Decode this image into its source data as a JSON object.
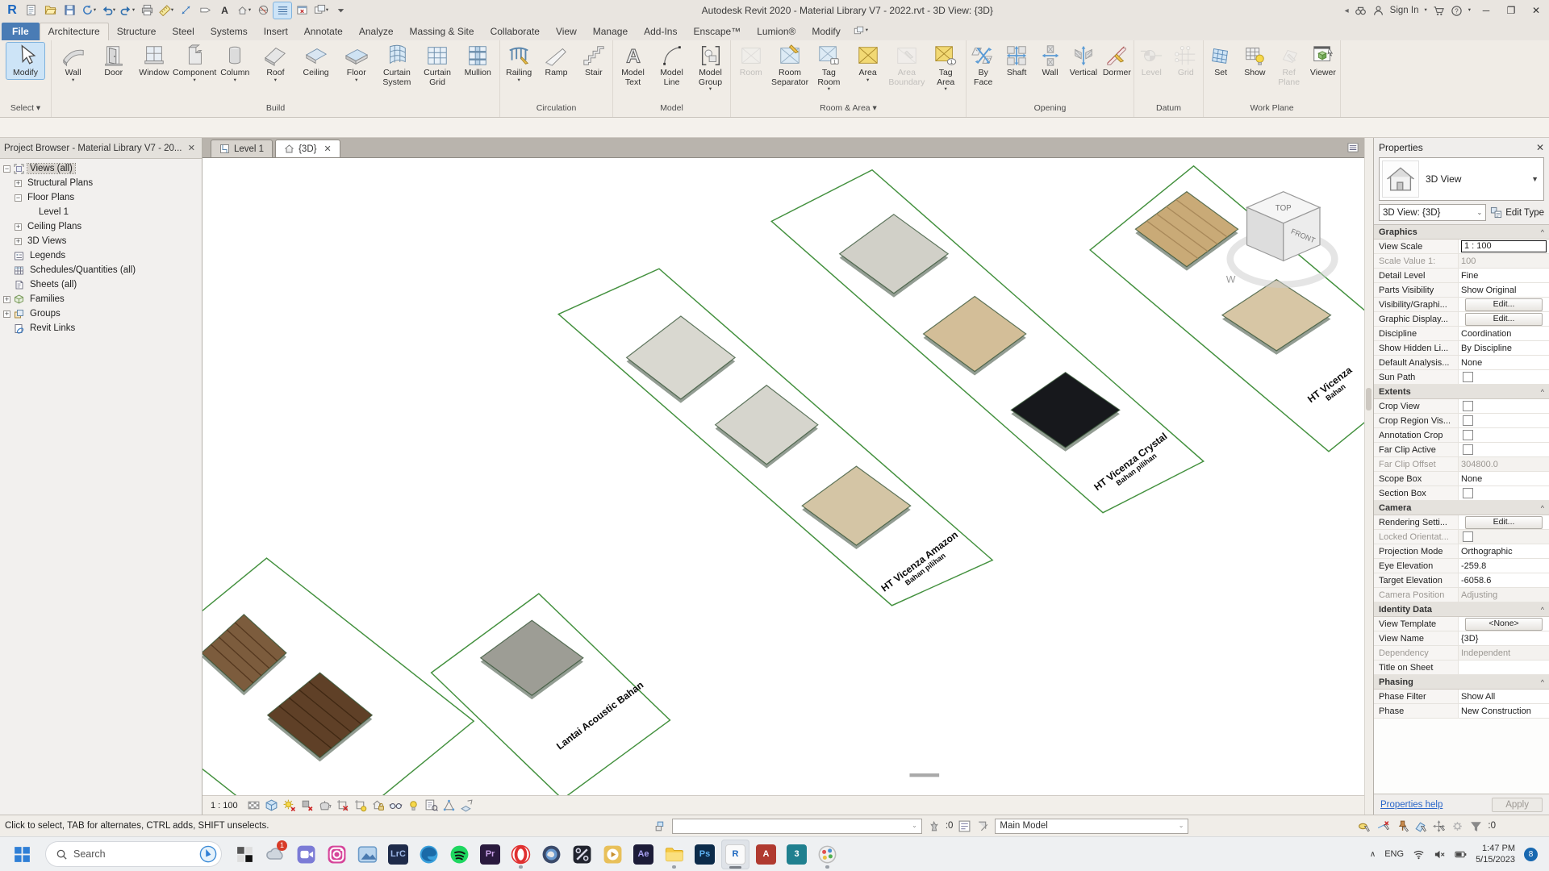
{
  "title_bar": {
    "title": "Autodesk Revit 2020 - Material Library V7 - 2022.rvt - 3D View: {3D}",
    "sign_in": "Sign In"
  },
  "qat": [
    {
      "icon": "doc"
    },
    {
      "icon": "open"
    },
    {
      "icon": "save"
    },
    {
      "icon": "sync",
      "arrow": true
    },
    {
      "icon": "undo",
      "arrow": true
    },
    {
      "icon": "redo",
      "arrow": true
    },
    {
      "icon": "print"
    },
    {
      "icon": "measure",
      "arrow": true
    },
    {
      "icon": "aligndim"
    },
    {
      "icon": "tagq"
    },
    {
      "icon": "texta"
    },
    {
      "icon": "cube3d",
      "arrow": true
    },
    {
      "icon": "section"
    },
    {
      "icon": "thinlines",
      "active": true
    },
    {
      "icon": "closehidden"
    },
    {
      "icon": "switchwin",
      "arrow": true
    },
    {
      "icon": "qatdrop"
    }
  ],
  "ribbon": {
    "tabs": [
      {
        "label": "File",
        "file": true
      },
      {
        "label": "Architecture",
        "active": true
      },
      {
        "label": "Structure"
      },
      {
        "label": "Steel"
      },
      {
        "label": "Systems"
      },
      {
        "label": "Insert"
      },
      {
        "label": "Annotate"
      },
      {
        "label": "Analyze"
      },
      {
        "label": "Massing & Site"
      },
      {
        "label": "Collaborate"
      },
      {
        "label": "View"
      },
      {
        "label": "Manage"
      },
      {
        "label": "Add-Ins"
      },
      {
        "label": "Enscape™"
      },
      {
        "label": "Lumion®"
      },
      {
        "label": "Modify"
      }
    ],
    "panels": [
      {
        "label": "Select ▾",
        "buttons": [
          {
            "label": "Modify",
            "icon": "modify",
            "selected": true
          }
        ]
      },
      {
        "label": "Build",
        "buttons": [
          {
            "label": "Wall",
            "icon": "wall",
            "arrow": true
          },
          {
            "label": "Door",
            "icon": "door"
          },
          {
            "label": "Window",
            "icon": "window"
          },
          {
            "label": "Component",
            "icon": "component",
            "arrow": true
          },
          {
            "label": "Column",
            "icon": "column",
            "arrow": true
          },
          {
            "label": "Roof",
            "icon": "roof",
            "arrow": true
          },
          {
            "label": "Ceiling",
            "icon": "ceiling"
          },
          {
            "label": "Floor",
            "icon": "floor",
            "arrow": true
          },
          {
            "label": "Curtain\nSystem",
            "icon": "curtainsys"
          },
          {
            "label": "Curtain\nGrid",
            "icon": "curtaingrid"
          },
          {
            "label": "Mullion",
            "icon": "mullion"
          }
        ]
      },
      {
        "label": "Circulation",
        "buttons": [
          {
            "label": "Railing",
            "icon": "railing",
            "arrow": true
          },
          {
            "label": "Ramp",
            "icon": "ramp"
          },
          {
            "label": "Stair",
            "icon": "stair"
          }
        ]
      },
      {
        "label": "Model",
        "buttons": [
          {
            "label": "Model\nText",
            "icon": "modeltext"
          },
          {
            "label": "Model\nLine",
            "icon": "modelline"
          },
          {
            "label": "Model\nGroup",
            "icon": "modelgroup",
            "arrow": true
          }
        ]
      },
      {
        "label": "Room & Area ▾",
        "buttons": [
          {
            "label": "Room",
            "icon": "room",
            "disabled": true
          },
          {
            "label": "Room\nSeparator",
            "icon": "roomsep"
          },
          {
            "label": "Tag\nRoom",
            "icon": "tagroom",
            "arrow": true
          },
          {
            "label": "Area",
            "icon": "area",
            "arrow": true
          },
          {
            "label": "Area\nBoundary",
            "icon": "areabnd",
            "disabled": true
          },
          {
            "label": "Tag\nArea",
            "icon": "tagarea",
            "arrow": true
          }
        ]
      },
      {
        "label": "Opening",
        "buttons": [
          {
            "label": "By\nFace",
            "icon": "byface"
          },
          {
            "label": "Shaft",
            "icon": "shaft"
          },
          {
            "label": "Wall",
            "icon": "wallopen"
          },
          {
            "label": "Vertical",
            "icon": "vertopen"
          },
          {
            "label": "Dormer",
            "icon": "dormer"
          }
        ]
      },
      {
        "label": "Datum",
        "buttons": [
          {
            "label": "Level",
            "icon": "level",
            "disabled": true
          },
          {
            "label": "Grid",
            "icon": "grid",
            "disabled": true
          }
        ]
      },
      {
        "label": "Work Plane",
        "buttons": [
          {
            "label": "Set",
            "icon": "set"
          },
          {
            "label": "Show",
            "icon": "show"
          },
          {
            "label": "Ref\nPlane",
            "icon": "refplane",
            "disabled": true
          },
          {
            "label": "Viewer",
            "icon": "viewer"
          }
        ]
      }
    ]
  },
  "project_browser": {
    "title": "Project Browser - Material Library V7 - 20...",
    "items": [
      {
        "label": "Views (all)",
        "level": 0,
        "exp": "minus",
        "icon": "views",
        "selected": true
      },
      {
        "label": "Structural Plans",
        "level": 1,
        "exp": "plus"
      },
      {
        "label": "Floor Plans",
        "level": 1,
        "exp": "minus"
      },
      {
        "label": "Level 1",
        "level": 2
      },
      {
        "label": "Ceiling Plans",
        "level": 1,
        "exp": "plus"
      },
      {
        "label": "3D Views",
        "level": 1,
        "exp": "plus"
      },
      {
        "label": "Legends",
        "level": 0,
        "icon": "legends"
      },
      {
        "label": "Schedules/Quantities (all)",
        "level": 0,
        "icon": "sched"
      },
      {
        "label": "Sheets (all)",
        "level": 0,
        "icon": "sheets"
      },
      {
        "label": "Families",
        "level": 0,
        "exp": "plus",
        "icon": "families"
      },
      {
        "label": "Groups",
        "level": 0,
        "exp": "plus",
        "icon": "groups"
      },
      {
        "label": "Revit Links",
        "level": 0,
        "icon": "links"
      }
    ]
  },
  "view_tabs": [
    {
      "label": "Level 1",
      "icon": "plan"
    },
    {
      "label": "{3D}",
      "icon": "home",
      "active": true,
      "closable": true
    }
  ],
  "viewport": {
    "sheet_labels": [
      {
        "text": "Lantai Acoustic Bahan",
        "line2": ""
      },
      {
        "text": "HT Vicenza Amazon",
        "line2": "Bahan pilihan"
      },
      {
        "text": "HT Vicenza Crystal",
        "line2": "Bahan pilihan"
      },
      {
        "text": "HT Vicenza",
        "line2": "Bahan"
      }
    ],
    "viewcube": {
      "top": "TOP",
      "front": "FRONT",
      "west": "W"
    }
  },
  "view_control_bar": {
    "scale": "1 : 100",
    "icons": [
      "detail-level",
      "visual-style",
      "sun-path",
      "shadows",
      "show-rendering-dialog",
      "crop-view",
      "show-crop-region",
      "unlocked-3d-view",
      "temporary-hide-isolate",
      "reveal-hidden-elements",
      "temporary-view-properties",
      "show-analytical-model",
      "highlight-displacement-sets"
    ]
  },
  "properties": {
    "header": "Properties",
    "type_category": "3D View",
    "selector_value": "3D View: {3D}",
    "edit_type_label": "Edit Type",
    "sections": [
      {
        "title": "Graphics",
        "rows": [
          {
            "label": "View Scale",
            "value": "1 : 100",
            "type": "input"
          },
          {
            "label": "Scale Value 1:",
            "value": "100",
            "disabled": true
          },
          {
            "label": "Detail Level",
            "value": "Fine"
          },
          {
            "label": "Parts Visibility",
            "value": "Show Original"
          },
          {
            "label": "Visibility/Graphi...",
            "value": "Edit...",
            "type": "button"
          },
          {
            "label": "Graphic Display...",
            "value": "Edit...",
            "type": "button"
          },
          {
            "label": "Discipline",
            "value": "Coordination"
          },
          {
            "label": "Show Hidden Li...",
            "value": "By Discipline"
          },
          {
            "label": "Default Analysis...",
            "value": "None"
          },
          {
            "label": "Sun Path",
            "type": "check"
          }
        ]
      },
      {
        "title": "Extents",
        "rows": [
          {
            "label": "Crop View",
            "type": "check"
          },
          {
            "label": "Crop Region Vis...",
            "type": "check"
          },
          {
            "label": "Annotation Crop",
            "type": "check"
          },
          {
            "label": "Far Clip Active",
            "type": "check"
          },
          {
            "label": "Far Clip Offset",
            "value": "304800.0",
            "disabled": true
          },
          {
            "label": "Scope Box",
            "value": "None"
          },
          {
            "label": "Section Box",
            "type": "check"
          }
        ]
      },
      {
        "title": "Camera",
        "rows": [
          {
            "label": "Rendering Setti...",
            "value": "Edit...",
            "type": "button"
          },
          {
            "label": "Locked Orientat...",
            "type": "check",
            "disabled": true
          },
          {
            "label": "Projection Mode",
            "value": "Orthographic"
          },
          {
            "label": "Eye Elevation",
            "value": "-259.8"
          },
          {
            "label": "Target Elevation",
            "value": "-6058.6"
          },
          {
            "label": "Camera Position",
            "value": "Adjusting",
            "disabled": true
          }
        ]
      },
      {
        "title": "Identity Data",
        "rows": [
          {
            "label": "View Template",
            "value": "<None>",
            "type": "button"
          },
          {
            "label": "View Name",
            "value": "{3D}"
          },
          {
            "label": "Dependency",
            "value": "Independent",
            "disabled": true
          },
          {
            "label": "Title on Sheet",
            "value": ""
          }
        ]
      },
      {
        "title": "Phasing",
        "rows": [
          {
            "label": "Phase Filter",
            "value": "Show All"
          },
          {
            "label": "Phase",
            "value": "New Construction"
          }
        ]
      }
    ],
    "help_link": "Properties help",
    "apply_label": "Apply"
  },
  "status_bar": {
    "message": "Click to select, TAB for alternates, CTRL adds, SHIFT unselects.",
    "worksets_value": "",
    "editable_count": ":0",
    "main_model": "Main Model",
    "filter_count": ":0"
  },
  "taskbar": {
    "search_placeholder": "Search",
    "apps": [
      {
        "name": "pinned-app",
        "icon": "squaresapp"
      },
      {
        "name": "onedrive",
        "icon": "cloud",
        "badge": "1"
      },
      {
        "name": "meet-app",
        "icon": "zoomapp"
      },
      {
        "name": "instagram",
        "icon": "instagram"
      },
      {
        "name": "photos",
        "icon": "photosapp"
      },
      {
        "name": "lightroom-classic",
        "glyph": "LrC",
        "bg": "#1e2b4a",
        "fg": "#9db8e8"
      },
      {
        "name": "edge",
        "icon": "edge"
      },
      {
        "name": "spotify",
        "icon": "spotify"
      },
      {
        "name": "premiere",
        "glyph": "Pr",
        "bg": "#2a1a3e",
        "fg": "#c9a1e8"
      },
      {
        "name": "opera",
        "icon": "opera",
        "running": true
      },
      {
        "name": "google-earth",
        "icon": "earth"
      },
      {
        "name": "premiere-rush",
        "icon": "rushapp"
      },
      {
        "name": "media-player",
        "icon": "playergold"
      },
      {
        "name": "after-effects",
        "glyph": "Ae",
        "bg": "#1c1c38",
        "fg": "#a8a0f0"
      },
      {
        "name": "file-explorer",
        "icon": "folder",
        "running": true
      },
      {
        "name": "photoshop",
        "glyph": "Ps",
        "bg": "#0c2b4a",
        "fg": "#5eb2f2"
      },
      {
        "name": "revit",
        "glyph": "R",
        "bg": "#fafafa",
        "fg": "#1a66c0",
        "active": true
      },
      {
        "name": "autocad",
        "glyph": "A",
        "bg": "#b03a30",
        "fg": "#ffffff"
      },
      {
        "name": "3ds-max",
        "glyph": "3",
        "bg": "#20808f",
        "fg": "#ffffff"
      },
      {
        "name": "paint",
        "icon": "paintapp",
        "running": true
      }
    ],
    "tray": {
      "lang": "ENG",
      "time": "1:47 PM",
      "date": "5/15/2023",
      "badge": "8"
    }
  }
}
